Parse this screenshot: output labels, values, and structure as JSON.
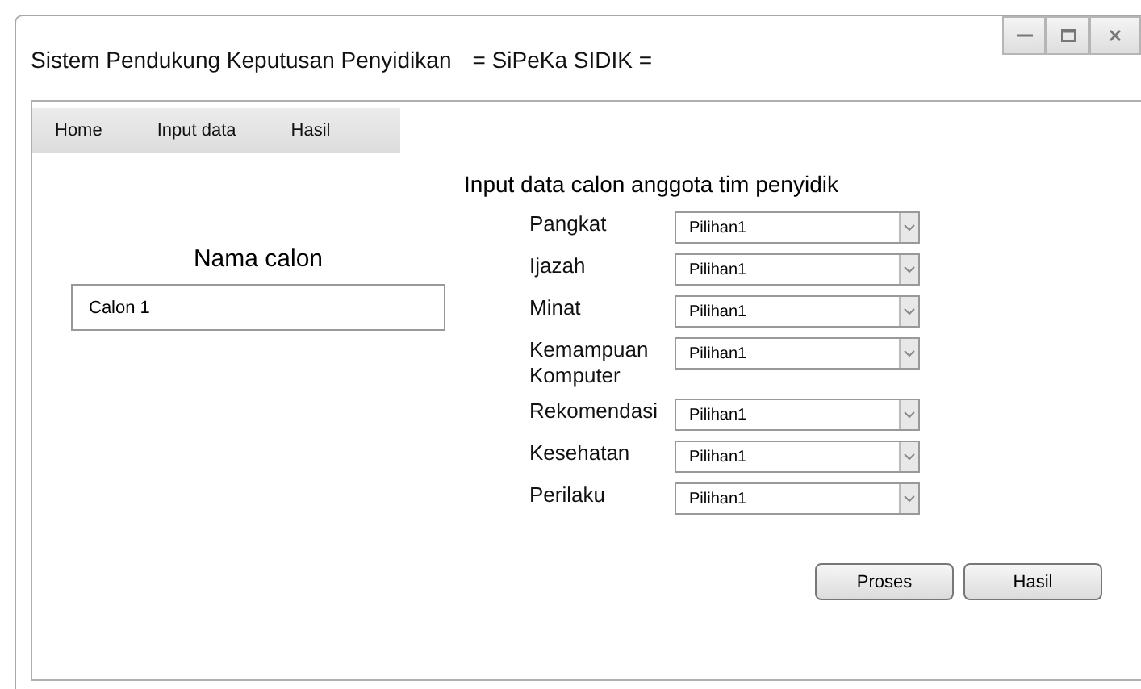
{
  "window": {
    "title": "Sistem Pendukung Keputusan Penyidikan",
    "subtitle": "= SiPeKa SIDIK ="
  },
  "menu": [
    {
      "label": "Home"
    },
    {
      "label": "Input data"
    },
    {
      "label": "Hasil"
    }
  ],
  "heading": "Input data calon anggota tim penyidik",
  "name_field": {
    "label": "Nama calon",
    "value": "Calon 1"
  },
  "criteria": [
    {
      "label": "Pangkat",
      "value": "Pilihan1"
    },
    {
      "label": "Ijazah",
      "value": "Pilihan1"
    },
    {
      "label": "Minat",
      "value": "Pilihan1"
    },
    {
      "label": "Kemampuan Komputer",
      "value": "Pilihan1"
    },
    {
      "label": "Rekomendasi",
      "value": "Pilihan1"
    },
    {
      "label": "Kesehatan",
      "value": "Pilihan1"
    },
    {
      "label": "Perilaku",
      "value": "Pilihan1"
    }
  ],
  "buttons": [
    "Proses",
    "Hasil"
  ]
}
